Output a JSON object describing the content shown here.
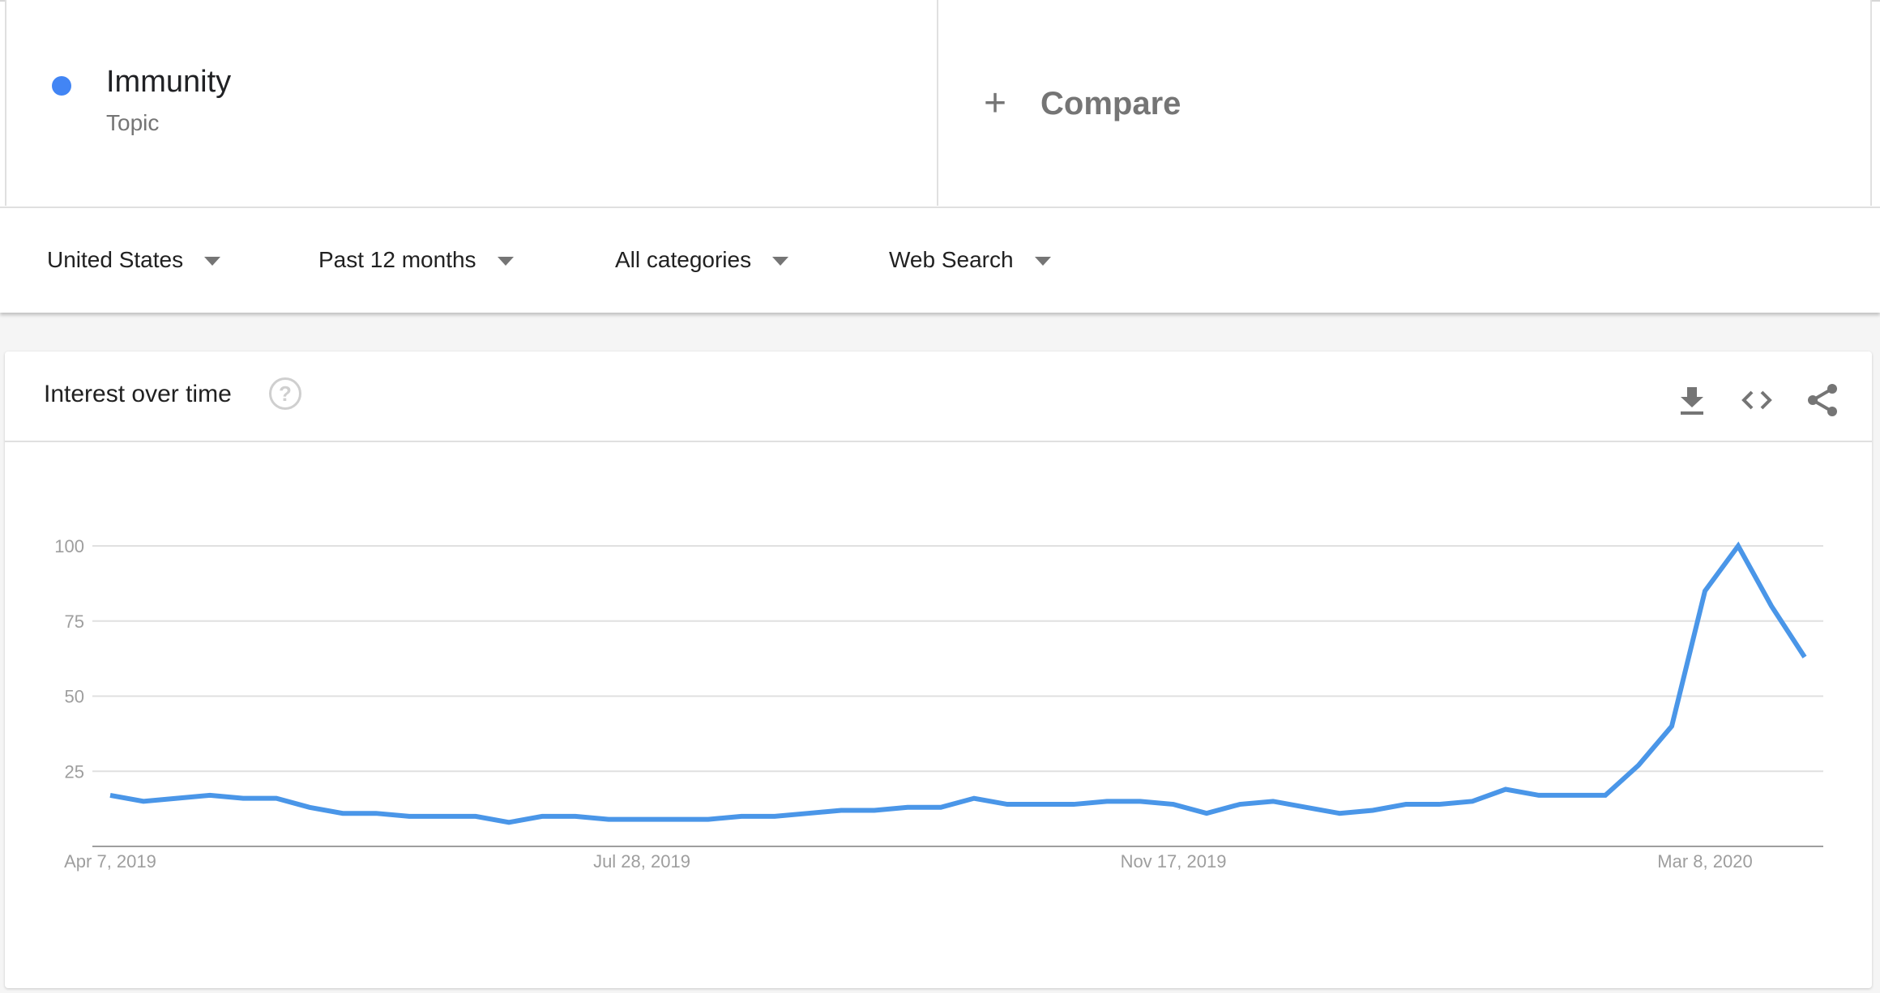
{
  "term": {
    "name": "Immunity",
    "type": "Topic",
    "color": "#4285f4"
  },
  "compare": {
    "label": "Compare",
    "icon": "plus-icon"
  },
  "filters": [
    {
      "label": "United States"
    },
    {
      "label": "Past 12 months"
    },
    {
      "label": "All categories"
    },
    {
      "label": "Web Search"
    }
  ],
  "card": {
    "title": "Interest over time",
    "help_icon": "?",
    "tools": [
      "download-icon",
      "embed-code-icon",
      "share-icon"
    ]
  },
  "chart_data": {
    "type": "line",
    "title": "Interest over time",
    "xlabel": "",
    "ylabel": "",
    "ylim": [
      0,
      100
    ],
    "yticks": [
      25,
      50,
      75,
      100
    ],
    "xtick_labels": [
      {
        "label": "Apr 7, 2019",
        "index": 0
      },
      {
        "label": "Jul 28, 2019",
        "index": 16
      },
      {
        "label": "Nov 17, 2019",
        "index": 32
      },
      {
        "label": "Mar 8, 2020",
        "index": 48
      }
    ],
    "grid": true,
    "series": [
      {
        "name": "Immunity",
        "color": "#4a96e8",
        "values": [
          17,
          15,
          16,
          17,
          16,
          16,
          13,
          11,
          11,
          10,
          10,
          10,
          8,
          10,
          10,
          9,
          9,
          9,
          9,
          10,
          10,
          11,
          12,
          12,
          13,
          13,
          16,
          14,
          14,
          14,
          15,
          15,
          14,
          11,
          14,
          15,
          13,
          11,
          12,
          14,
          14,
          15,
          19,
          17,
          17,
          17,
          27,
          40,
          85,
          100,
          80,
          63
        ]
      }
    ]
  }
}
